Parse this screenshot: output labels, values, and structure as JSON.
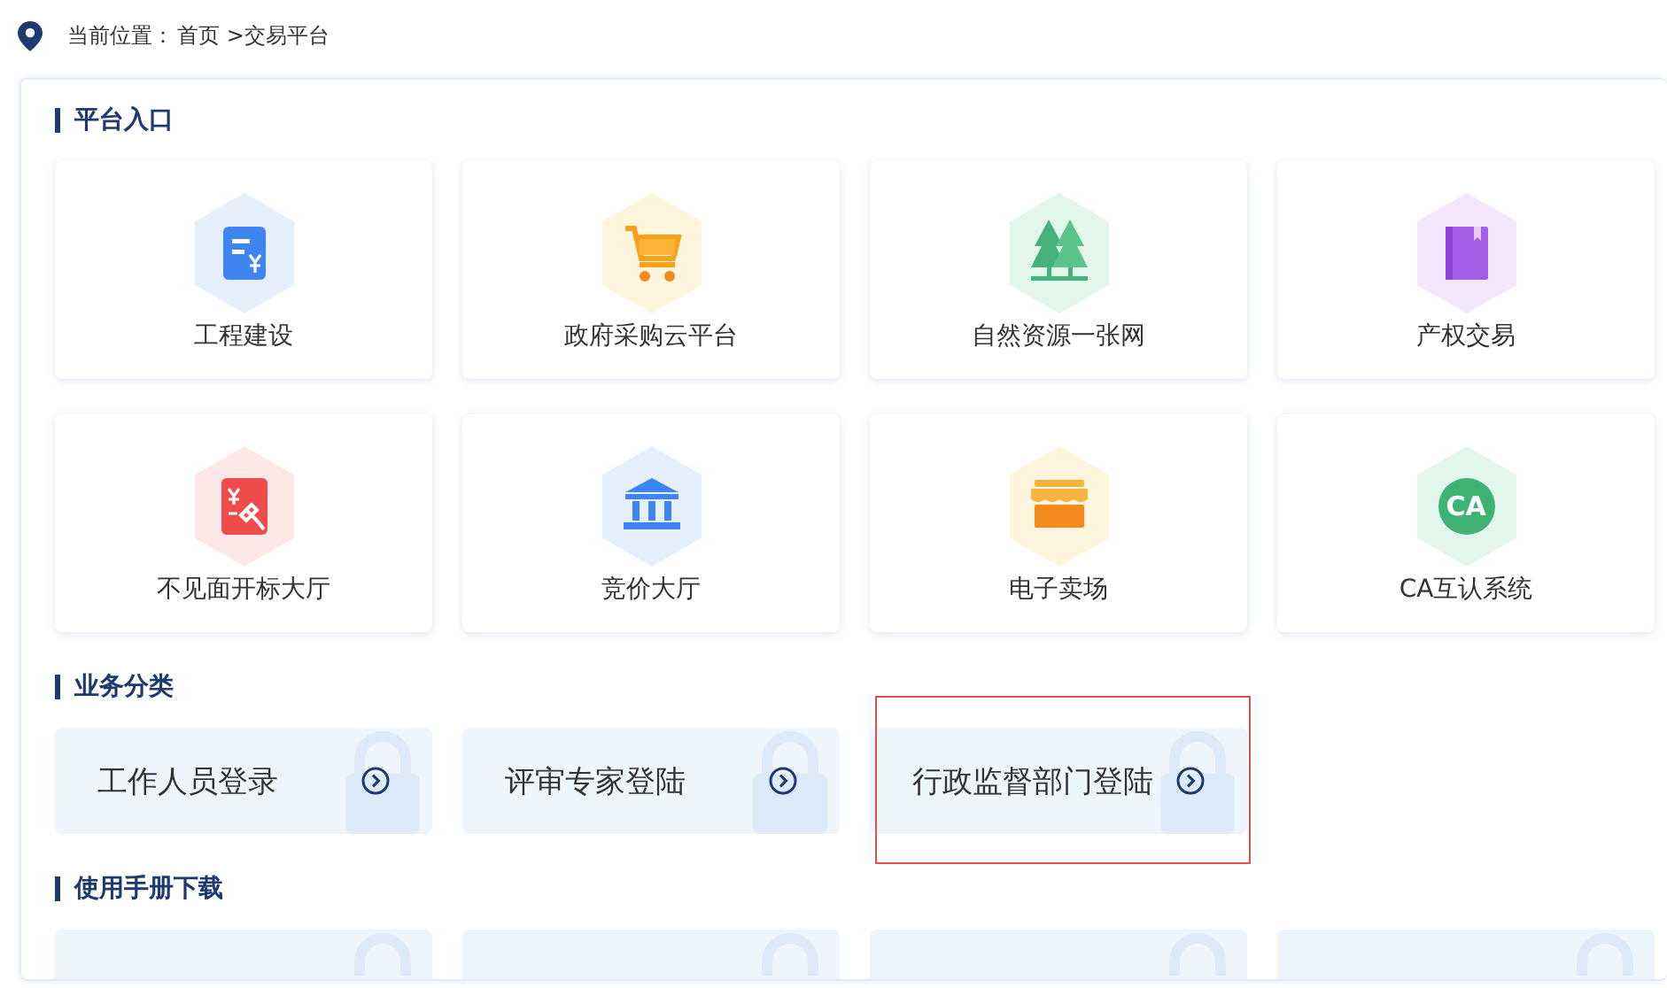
{
  "breadcrumb": {
    "label": "当前位置：",
    "path": "首页 >交易平台"
  },
  "sections": [
    {
      "title": "平台入口",
      "kind": "platform",
      "items": [
        {
          "label": "工程建设"
        },
        {
          "label": "政府采购云平台"
        },
        {
          "label": "自然资源一张网"
        },
        {
          "label": "产权交易"
        },
        {
          "label": "不见面开标大厅"
        },
        {
          "label": "竞价大厅"
        },
        {
          "label": "电子卖场"
        },
        {
          "label": "CA互认系统",
          "icon_text": "CA"
        }
      ]
    },
    {
      "title": "业务分类",
      "kind": "login",
      "items": [
        {
          "label": "工作人员登录",
          "selected": false
        },
        {
          "label": "评审专家登陆",
          "selected": false
        },
        {
          "label": "行政监督部门登陆",
          "selected": true
        }
      ]
    },
    {
      "title": "使用手册下载",
      "kind": "manual"
    }
  ]
}
